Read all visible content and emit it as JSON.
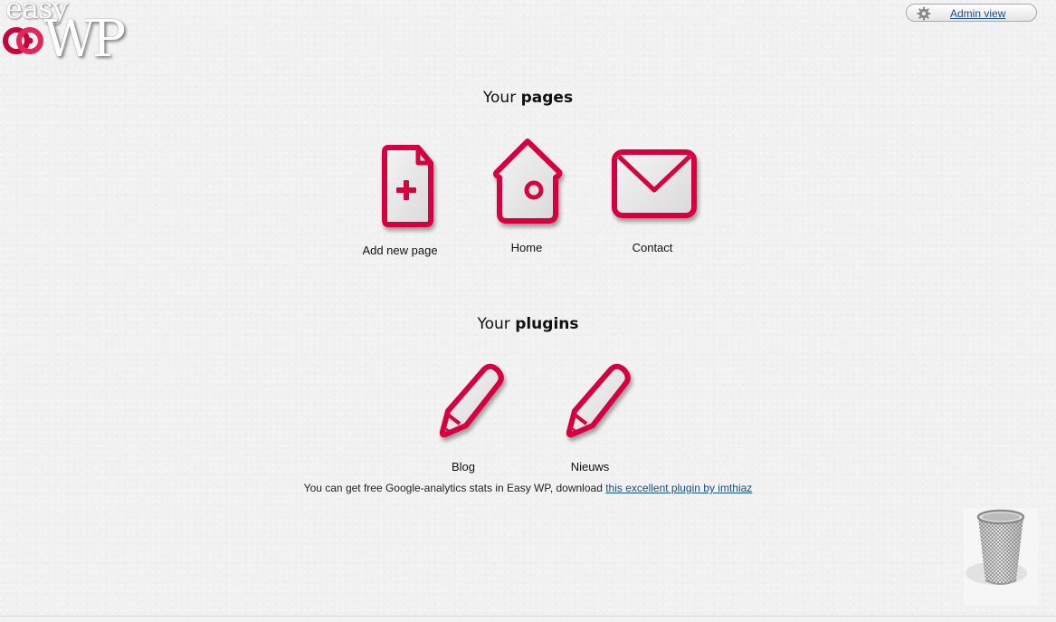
{
  "logo": {
    "easy_text": "easy",
    "wp_text": "WP"
  },
  "admin": {
    "label": "Admin view"
  },
  "pages_section": {
    "title_prefix": "Your",
    "title_bold": "pages",
    "items": [
      {
        "label": "Add new page",
        "icon": "add-page-icon"
      },
      {
        "label": "Home",
        "icon": "house-icon"
      },
      {
        "label": "Contact",
        "icon": "envelope-icon"
      }
    ]
  },
  "plugins_section": {
    "title_prefix": "Your",
    "title_bold": "plugins",
    "items": [
      {
        "label": "Blog",
        "icon": "pencil-icon"
      },
      {
        "label": "Nieuws",
        "icon": "pencil-icon"
      }
    ]
  },
  "note": {
    "text": "You can get free Google-analytics stats in Easy WP, download",
    "link": "this excellent plugin by imthiaz"
  },
  "trash": {
    "icon": "trash-bin-icon"
  },
  "colors": {
    "accent": "#d4043f",
    "link": "#1a4f86"
  }
}
